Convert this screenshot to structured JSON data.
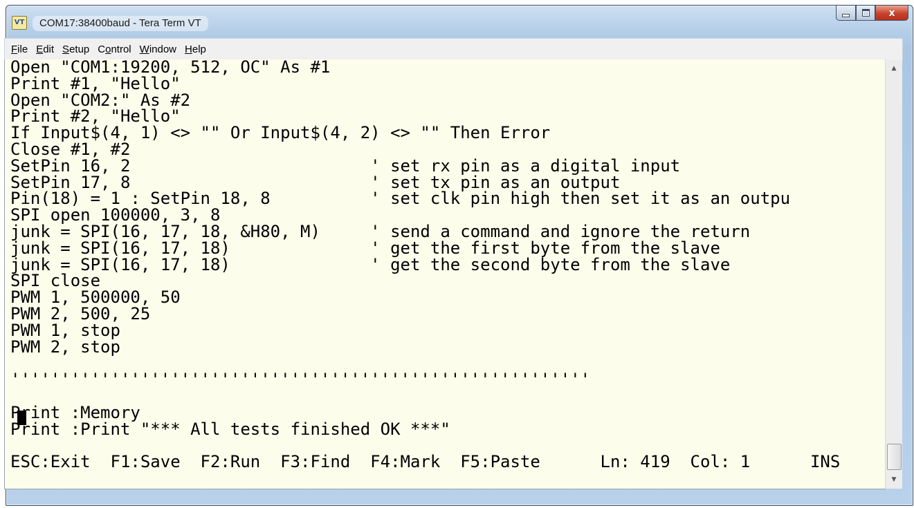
{
  "window": {
    "title": "COM17:38400baud - Tera Term VT",
    "icon": "tera-term-icon",
    "app_icon_text": "VT"
  },
  "menu": [
    {
      "label": "File",
      "accel": "F",
      "rest": "ile"
    },
    {
      "label": "Edit",
      "accel": "E",
      "rest": "dit"
    },
    {
      "label": "Setup",
      "accel": "S",
      "rest": "etup"
    },
    {
      "label": "Control",
      "pre": "C",
      "accel": "o",
      "rest": "ntrol"
    },
    {
      "label": "Window",
      "accel": "W",
      "rest": "indow"
    },
    {
      "label": "Help",
      "accel": "H",
      "rest": "elp"
    }
  ],
  "terminal": {
    "lines": [
      "Open \"COM1:19200, 512, OC\" As #1",
      "Print #1, \"Hello\"",
      "Open \"COM2:\" As #2",
      "Print #2, \"Hello\"",
      "If Input$(4, 1) <> \"\" Or Input$(4, 2) <> \"\" Then Error",
      "Close #1, #2",
      "SetPin 16, 2                        ' set rx pin as a digital input",
      "SetPin 17, 8                        ' set tx pin as an output",
      "Pin(18) = 1 : SetPin 18, 8          ' set clk pin high then set it as an outpu",
      "SPI open 100000, 3, 8",
      "junk = SPI(16, 17, 18, &H80, M)     ' send a command and ignore the return",
      "junk = SPI(16, 17, 18)              ' get the first byte from the slave",
      "junk = SPI(16, 17, 18)              ' get the second byte from the slave",
      "SPI close",
      "PWM 1, 500000, 50",
      "PWM 2, 500, 25",
      "PWM 1, stop",
      "PWM 2, stop",
      "",
      "''''''''''''''''''''''''''''''''''''''''''''''''''''''''''",
      "",
      "Print :Memory",
      "Print :Print \"*** All tests finished OK ***\"",
      "",
      "ESC:Exit  F1:Save  F2:Run  F3:Find  F4:Mark  F5:Paste      Ln: 419  Col: 1      INS"
    ]
  },
  "scrollbar": {
    "up_arrow": "▲",
    "down_arrow": "▼"
  }
}
